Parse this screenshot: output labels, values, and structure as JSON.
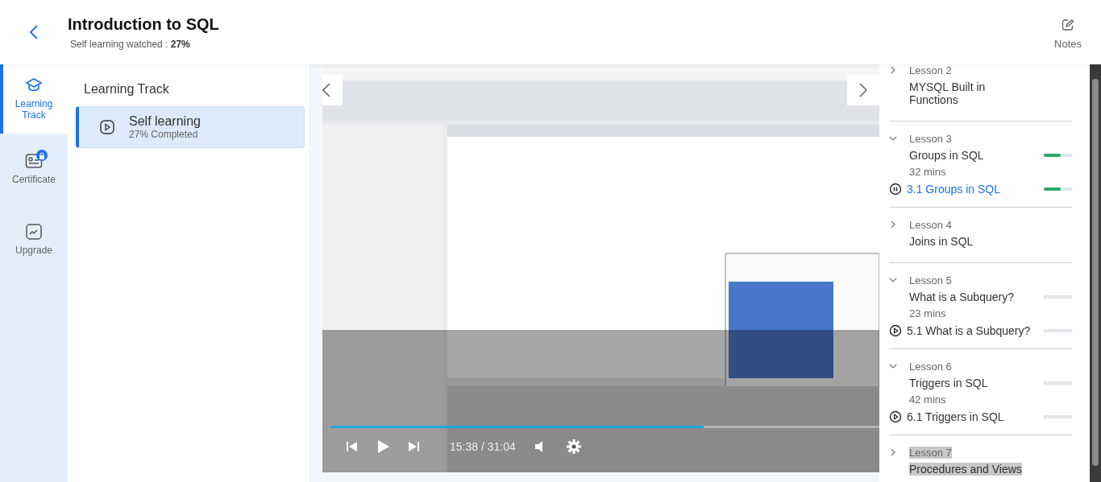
{
  "header": {
    "title": "Introduction to SQL",
    "subtitle": "Self learning watched : **27%**",
    "notes_label": "Notes"
  },
  "nav": [
    {
      "label": "Learning Track",
      "selected": true,
      "locked": false
    },
    {
      "label": "Certificate",
      "selected": false,
      "locked": true
    },
    {
      "label": "Upgrade",
      "selected": false,
      "locked": false
    }
  ],
  "track": {
    "heading": "Learning Track",
    "items": [
      {
        "title": "Self learning",
        "progress": "27% Completed",
        "selected": true
      }
    ]
  },
  "video": {
    "kind": "picture",
    "level": 0.68,
    "time": "15:38 / 31:04"
  },
  "lessons": [
    {
      "label": "Lesson 2",
      "title": "MYSQL Built in Functions",
      "expanded": false,
      "highlighted": false
    },
    {
      "label": "Lesson 3",
      "title": "Groups in SQL",
      "duration": "32 mins",
      "level": 0.6,
      "expanded": true,
      "highlighted": false,
      "children": [
        {
          "title": "3.1 Groups in SQL",
          "selected": true,
          "level": 0.6
        }
      ]
    },
    {
      "label": "Lesson 4",
      "title": "Joins in SQL",
      "expanded": false,
      "highlighted": false
    },
    {
      "label": "Lesson 5",
      "title": "What is a Subquery?",
      "duration": "23 mins",
      "level": 0,
      "expanded": true,
      "highlighted": false,
      "children": [
        {
          "title": "5.1 What is a Subquery?",
          "selected": false,
          "level": 0
        }
      ]
    },
    {
      "label": "Lesson 6",
      "title": "Triggers in SQL",
      "duration": "42 mins",
      "level": 0,
      "expanded": true,
      "highlighted": false,
      "children": [
        {
          "title": "6.1 Triggers in SQL",
          "selected": false,
          "level": 0
        }
      ]
    },
    {
      "label": "Lesson 7",
      "title": "Procedures and Views",
      "expanded": false,
      "highlighted": true
    }
  ]
}
